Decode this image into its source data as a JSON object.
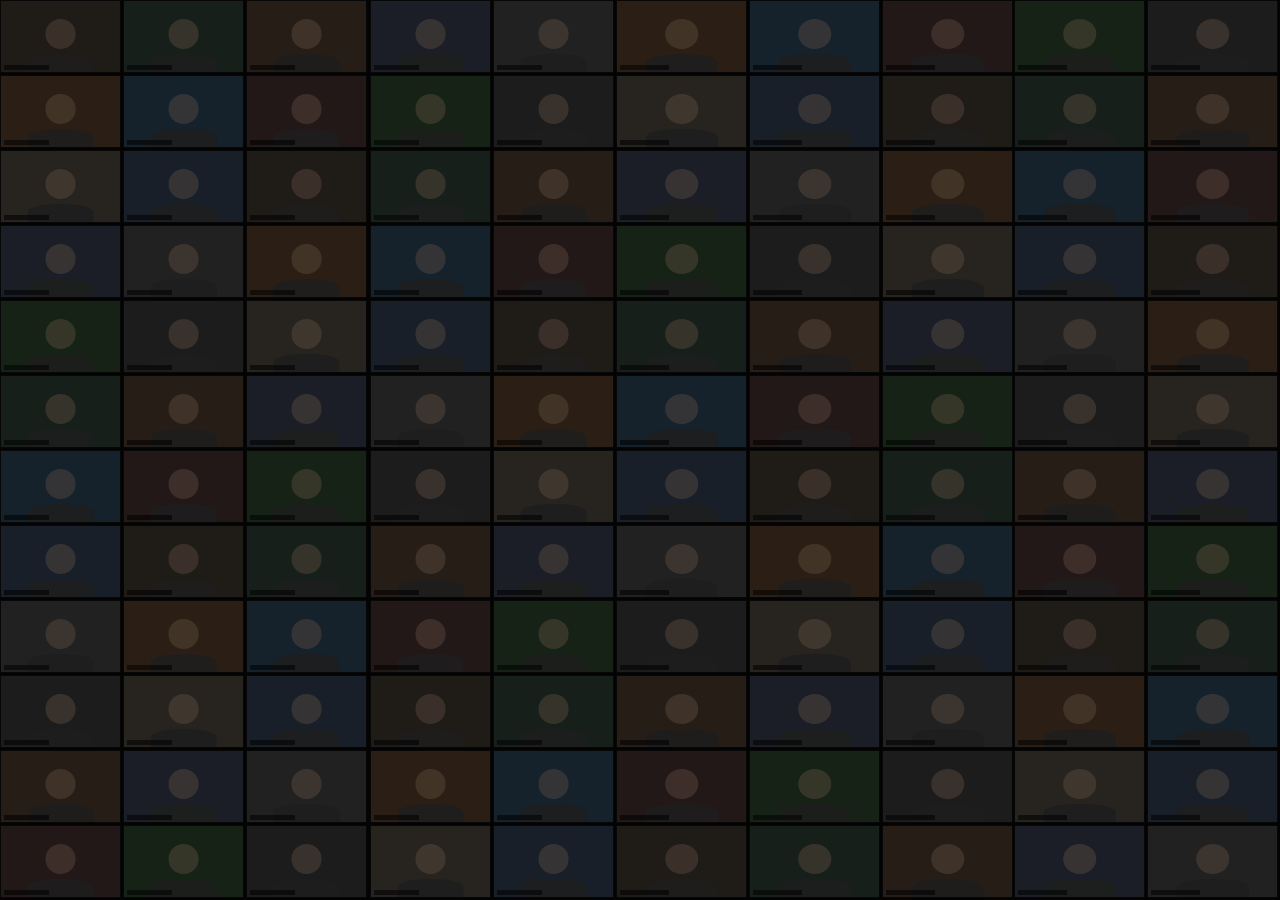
{
  "description_free": true,
  "left_grid": {
    "rows_upper": 5,
    "cols_upper": 5,
    "rows_lower": 7,
    "cols_lower": 5
  },
  "right_grid": {
    "rows_upper": 5,
    "cols_upper": 5,
    "rows_lower": 7,
    "cols_lower": 5
  },
  "palette": [
    "#2a241f",
    "#1f2a24",
    "#33271f",
    "#242833",
    "#2c2c2c",
    "#3a2a1c",
    "#1c2c3a",
    "#2f2020",
    "#1e2e1e",
    "#262626",
    "#34302a",
    "#202a36"
  ]
}
